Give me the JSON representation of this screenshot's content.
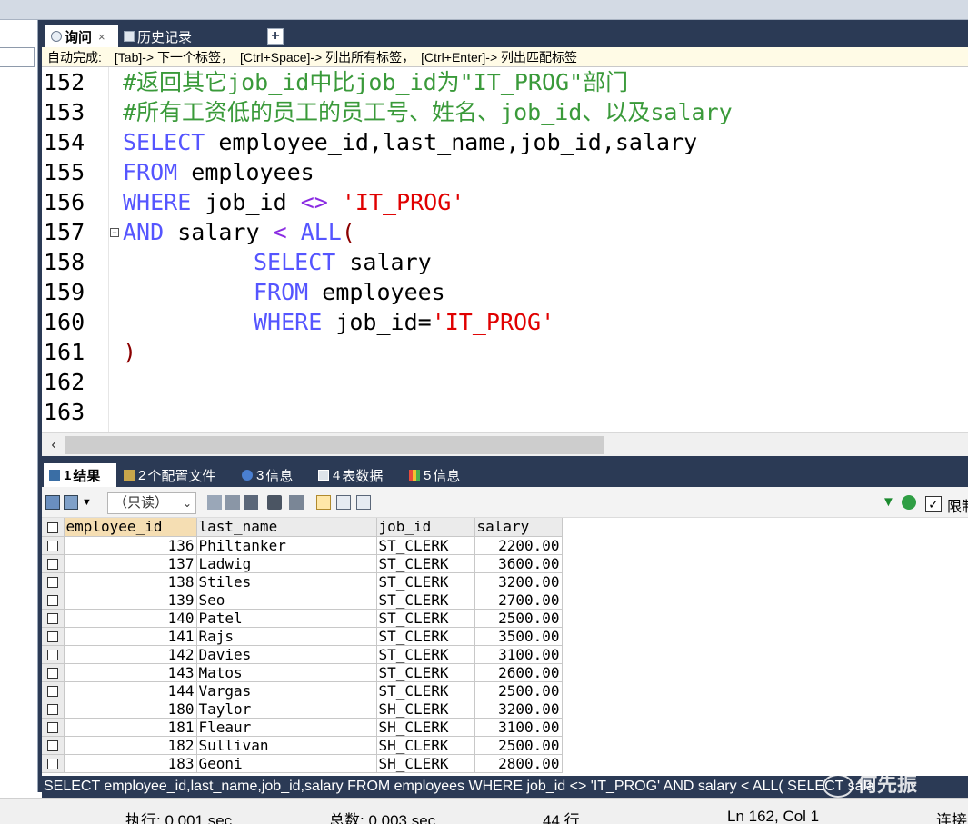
{
  "tabs": {
    "query_label": "询问",
    "query_close": "×",
    "history_label": "历史记录",
    "new_tab": "+"
  },
  "hint": "自动完成:　[Tab]-> 下一个标签，　[Ctrl+Space]-> 列出所有标签，　[Ctrl+Enter]-> 列出匹配标签",
  "editor": {
    "line_numbers": [
      "152",
      "153",
      "154",
      "155",
      "156",
      "157",
      "158",
      "159",
      "160",
      "161",
      "162",
      "163"
    ],
    "comment1": "#返回其它job_id中比job_id为\"IT_PROG\"部门",
    "comment2": "#所有工资低的员工的员工号、姓名、job_id、以及salary",
    "select_kw": "SELECT",
    "select_cols": " employee_id,last_name,job_id,salary",
    "from_kw": "FROM",
    "from_tbl": " employees",
    "where_kw": "WHERE",
    "where_col": " job_id ",
    "neq": "<>",
    "it_prog": "'IT_PROG'",
    "and_kw": "AND",
    "salary_word": " salary ",
    "lt": "<",
    "all_kw": "ALL",
    "lparen": "(",
    "sub_select_kw": "SELECT",
    "sub_select_col": " salary",
    "sub_from_kw": "FROM",
    "sub_from_tbl": " employees",
    "sub_where_kw": "WHERE",
    "sub_where_col": " job_id=",
    "sub_it_prog": "'IT_PROG'",
    "rparen": ")",
    "fold_toggle": "−"
  },
  "result_tabs": [
    {
      "num": "1",
      "label": "结果"
    },
    {
      "num": "2",
      "label": "个配置文件"
    },
    {
      "num": "3",
      "label": "信息"
    },
    {
      "num": "4",
      "label": "表数据"
    },
    {
      "num": "5",
      "label": "信息"
    }
  ],
  "toolbar": {
    "readonly": "（只读）",
    "limit_label": "限制",
    "limit_checked": "✓"
  },
  "grid": {
    "columns": [
      "employee_id",
      "last_name",
      "job_id",
      "salary"
    ],
    "rows": [
      [
        "136",
        "Philtanker",
        "ST_CLERK",
        "2200.00"
      ],
      [
        "137",
        "Ladwig",
        "ST_CLERK",
        "3600.00"
      ],
      [
        "138",
        "Stiles",
        "ST_CLERK",
        "3200.00"
      ],
      [
        "139",
        "Seo",
        "ST_CLERK",
        "2700.00"
      ],
      [
        "140",
        "Patel",
        "ST_CLERK",
        "2500.00"
      ],
      [
        "141",
        "Rajs",
        "ST_CLERK",
        "3500.00"
      ],
      [
        "142",
        "Davies",
        "ST_CLERK",
        "3100.00"
      ],
      [
        "143",
        "Matos",
        "ST_CLERK",
        "2600.00"
      ],
      [
        "144",
        "Vargas",
        "ST_CLERK",
        "2500.00"
      ],
      [
        "180",
        "Taylor",
        "SH_CLERK",
        "3200.00"
      ],
      [
        "181",
        "Fleaur",
        "SH_CLERK",
        "3100.00"
      ],
      [
        "182",
        "Sullivan",
        "SH_CLERK",
        "2500.00"
      ],
      [
        "183",
        "Geoni",
        "SH_CLERK",
        "2800.00"
      ]
    ]
  },
  "sql_status": "SELECT employee_id,last_name,job_id,salary FROM employees WHERE job_id <> 'IT_PROG' AND salary < ALL( SELECT sala",
  "watermark": "何先振",
  "status": {
    "exec": "执行: 0.001 sec",
    "total": "总数: 0.003 sec",
    "rows": "44 行",
    "position": "Ln 162, Col 1",
    "conn": "连接"
  },
  "colors": {
    "dark_bar": "#2b3a55",
    "keyword": "#5555ff",
    "comment": "#3a9a3a",
    "string": "#e00000",
    "operator": "#8a2be2"
  }
}
